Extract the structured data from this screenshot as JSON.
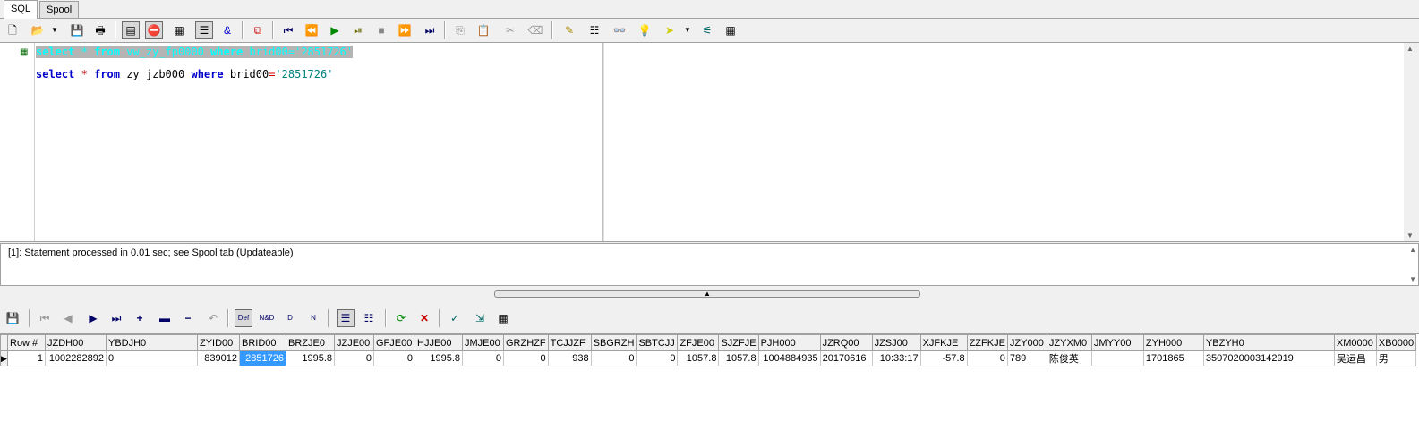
{
  "tabs": [
    "SQL",
    "Spool"
  ],
  "editor": {
    "line1": {
      "select": "select",
      "star": "*",
      "from": "from",
      "table": "vw_zy_fp0000",
      "where": "where",
      "col": "brid00",
      "eq": "=",
      "val": "'2851726'"
    },
    "line2": {
      "select": "select",
      "star": "*",
      "from": "from",
      "table": "zy_jzb000",
      "where": "where",
      "col": "brid00",
      "eq": "=",
      "val": "'2851726'"
    }
  },
  "status_message": "[1]: Statement processed in 0.01 sec; see Spool tab (Updateable)",
  "grid": {
    "columns": [
      "Row #",
      "JZDH00",
      "YBDJH0",
      "ZYID00",
      "BRID00",
      "BRZJE0",
      "JZJE00",
      "GFJE00",
      "HJJE00",
      "JMJE00",
      "GRZHZF",
      "TCJJZF",
      "SBGRZH",
      "SBTCJJ",
      "ZFJE00",
      "SJZFJE",
      "PJH000",
      "JZRQ00",
      "JZSJ00",
      "XJFKJE",
      "ZZFKJE",
      "JZY000",
      "JZYXM0",
      "JMYY00",
      "ZYH000",
      "YBZYH0",
      "XM0000",
      "XB0000"
    ],
    "rows": [
      [
        "1",
        "1002282892",
        "0",
        "839012",
        "2851726",
        "1995.8",
        "0",
        "0",
        "1995.8",
        "0",
        "0",
        "938",
        "0",
        "0",
        "1057.8",
        "1057.8",
        "1004884935",
        "20170616",
        "10:33:17",
        "-57.8",
        "0",
        "789",
        "陈俊英",
        "",
        "1701865",
        "3507020003142919",
        "吴运昌",
        "男"
      ]
    ]
  },
  "toolbar_icons": [
    "new",
    "open-sql",
    "save",
    "print",
    "execute",
    "stop",
    "explain",
    "check",
    "find-replace",
    "run",
    "first",
    "prev",
    "play",
    "step",
    "stop-small",
    "next",
    "last",
    "copy",
    "paste",
    "cut",
    "clear",
    "spell",
    "list",
    "binoculars",
    "bulb",
    "arrow",
    "tree",
    "grid"
  ],
  "grid_toolbar_icons": [
    "save",
    "first",
    "prev",
    "next",
    "last",
    "add",
    "append",
    "delete",
    "undo",
    "def",
    "nd",
    "d",
    "n",
    "grid",
    "form",
    "refresh",
    "clear",
    "check",
    "export",
    "table"
  ]
}
